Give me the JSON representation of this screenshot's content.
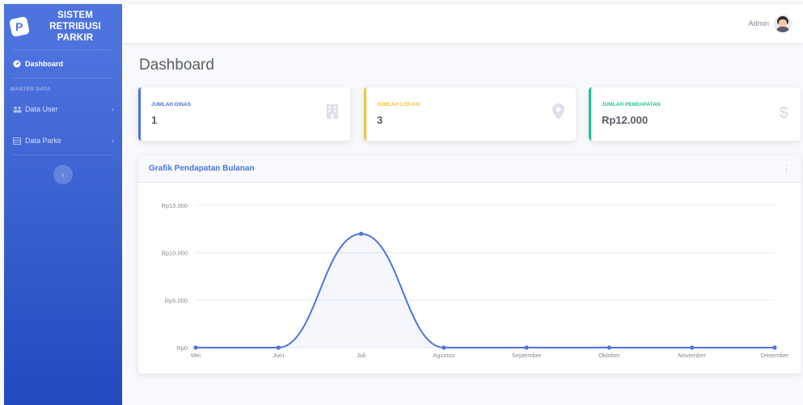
{
  "brand": {
    "logo_letter": "P",
    "line1": "SISTEM",
    "line2": "RETRIBUSI",
    "line3": "PARKIR"
  },
  "sidebar": {
    "dashboard_label": "Dashboard",
    "section_heading": "MASTER DATA",
    "items": [
      {
        "label": "Data User",
        "icon": "users-icon"
      },
      {
        "label": "Data Parkir",
        "icon": "table-icon"
      }
    ],
    "toggle_glyph": "‹"
  },
  "topbar": {
    "user_name": "Admin"
  },
  "page": {
    "title": "Dashboard"
  },
  "stats": [
    {
      "title": "JUMLAH DINAS",
      "value": "1",
      "icon": "building-icon",
      "color": "#4e73df"
    },
    {
      "title": "JUMLAH LOKASI",
      "value": "3",
      "icon": "map-marker-icon",
      "color": "#f6c23e"
    },
    {
      "title": "JUMLAH PENDAPATAN",
      "value": "Rp12.000",
      "icon": "dollar-icon",
      "color": "#1cc88a"
    }
  ],
  "chart_card": {
    "title": "Grafik Pendapatan Bulanan"
  },
  "chart_data": {
    "type": "line",
    "title": "Grafik Pendapatan Bulanan",
    "categories": [
      "Mei",
      "Juni",
      "Juli",
      "Agustus",
      "September",
      "Oktober",
      "November",
      "Desember"
    ],
    "series": [
      {
        "values": [
          0,
          0,
          12000,
          0,
          0,
          0,
          0,
          0
        ],
        "color": "#4e73df"
      }
    ],
    "yticks": [
      "Rp0",
      "Rp5.000",
      "Rp10.000",
      "Rp15.000"
    ],
    "ylim": [
      0,
      15000
    ],
    "grid": true,
    "fill": true,
    "smooth": true
  }
}
